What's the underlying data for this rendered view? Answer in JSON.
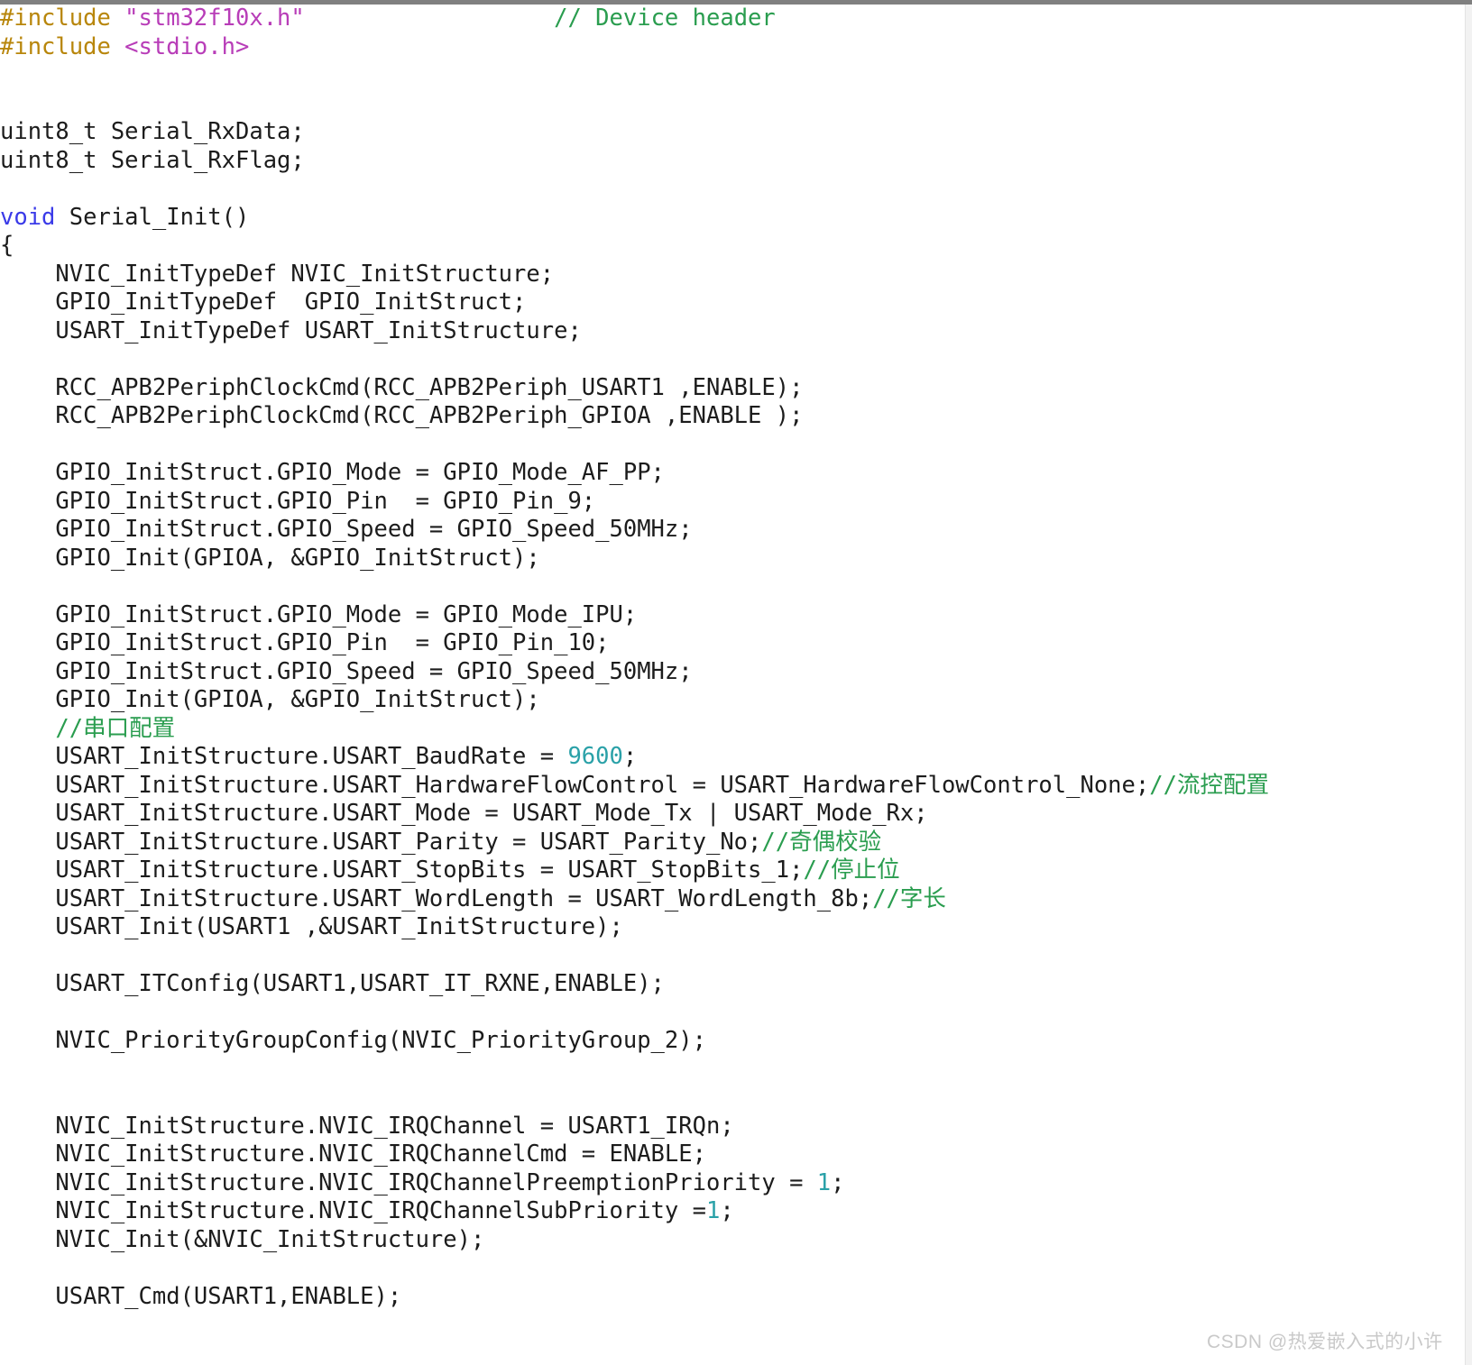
{
  "editor": {
    "language": "c",
    "colors": {
      "preprocessor": "#b8860b",
      "string": "#b83db8",
      "comment": "#2a9d4f",
      "keyword": "#3a3ae8",
      "number": "#2aa1a8",
      "text": "#1c1c1c",
      "background": "#ffffff",
      "topbar": "#808080",
      "scrollbar": "#f2f2f2"
    }
  },
  "watermark": {
    "text": "CSDN @热爱嵌入式的小许"
  },
  "code": {
    "lines": [
      {
        "id": 1,
        "segments": [
          {
            "cls": "pp",
            "t": "#include "
          },
          {
            "cls": "str",
            "t": "\"stm32f10x.h\""
          },
          {
            "cls": "plain",
            "t": "                  "
          },
          {
            "cls": "cmt",
            "t": "// Device header"
          }
        ]
      },
      {
        "id": 2,
        "segments": [
          {
            "cls": "pp",
            "t": "#include "
          },
          {
            "cls": "str",
            "t": "<stdio.h>"
          }
        ]
      },
      {
        "id": 3,
        "segments": [
          {
            "cls": "plain",
            "t": ""
          }
        ]
      },
      {
        "id": 4,
        "segments": [
          {
            "cls": "plain",
            "t": ""
          }
        ]
      },
      {
        "id": 5,
        "segments": [
          {
            "cls": "plain",
            "t": "uint8_t Serial_RxData;"
          }
        ]
      },
      {
        "id": 6,
        "segments": [
          {
            "cls": "plain",
            "t": "uint8_t Serial_RxFlag;"
          }
        ]
      },
      {
        "id": 7,
        "segments": [
          {
            "cls": "plain",
            "t": ""
          }
        ]
      },
      {
        "id": 8,
        "segments": [
          {
            "cls": "kw",
            "t": "void"
          },
          {
            "cls": "plain",
            "t": " Serial_Init()"
          }
        ]
      },
      {
        "id": 9,
        "segments": [
          {
            "cls": "plain",
            "t": "{"
          }
        ]
      },
      {
        "id": 10,
        "segments": [
          {
            "cls": "plain",
            "t": "    NVIC_InitTypeDef NVIC_InitStructure;"
          }
        ]
      },
      {
        "id": 11,
        "segments": [
          {
            "cls": "plain",
            "t": "    GPIO_InitTypeDef  GPIO_InitStruct;"
          }
        ]
      },
      {
        "id": 12,
        "segments": [
          {
            "cls": "plain",
            "t": "    USART_InitTypeDef USART_InitStructure;"
          }
        ]
      },
      {
        "id": 13,
        "segments": [
          {
            "cls": "plain",
            "t": ""
          }
        ]
      },
      {
        "id": 14,
        "segments": [
          {
            "cls": "plain",
            "t": "    RCC_APB2PeriphClockCmd(RCC_APB2Periph_USART1 ,ENABLE);"
          }
        ]
      },
      {
        "id": 15,
        "segments": [
          {
            "cls": "plain",
            "t": "    RCC_APB2PeriphClockCmd(RCC_APB2Periph_GPIOA ,ENABLE );"
          }
        ]
      },
      {
        "id": 16,
        "segments": [
          {
            "cls": "plain",
            "t": ""
          }
        ]
      },
      {
        "id": 17,
        "segments": [
          {
            "cls": "plain",
            "t": "    GPIO_InitStruct.GPIO_Mode = GPIO_Mode_AF_PP;"
          }
        ]
      },
      {
        "id": 18,
        "segments": [
          {
            "cls": "plain",
            "t": "    GPIO_InitStruct.GPIO_Pin  = GPIO_Pin_9;"
          }
        ]
      },
      {
        "id": 19,
        "segments": [
          {
            "cls": "plain",
            "t": "    GPIO_InitStruct.GPIO_Speed = GPIO_Speed_50MHz;"
          }
        ]
      },
      {
        "id": 20,
        "segments": [
          {
            "cls": "plain",
            "t": "    GPIO_Init(GPIOA, &GPIO_InitStruct);"
          }
        ]
      },
      {
        "id": 21,
        "segments": [
          {
            "cls": "plain",
            "t": ""
          }
        ]
      },
      {
        "id": 22,
        "segments": [
          {
            "cls": "plain",
            "t": "    GPIO_InitStruct.GPIO_Mode = GPIO_Mode_IPU;"
          }
        ]
      },
      {
        "id": 23,
        "segments": [
          {
            "cls": "plain",
            "t": "    GPIO_InitStruct.GPIO_Pin  = GPIO_Pin_10;"
          }
        ]
      },
      {
        "id": 24,
        "segments": [
          {
            "cls": "plain",
            "t": "    GPIO_InitStruct.GPIO_Speed = GPIO_Speed_50MHz;"
          }
        ]
      },
      {
        "id": 25,
        "segments": [
          {
            "cls": "plain",
            "t": "    GPIO_Init(GPIOA, &GPIO_InitStruct);"
          }
        ]
      },
      {
        "id": 26,
        "segments": [
          {
            "cls": "plain",
            "t": "    "
          },
          {
            "cls": "cmt",
            "t": "//串口配置"
          }
        ]
      },
      {
        "id": 27,
        "segments": [
          {
            "cls": "plain",
            "t": "    USART_InitStructure.USART_BaudRate = "
          },
          {
            "cls": "num",
            "t": "9600"
          },
          {
            "cls": "plain",
            "t": ";"
          }
        ]
      },
      {
        "id": 28,
        "segments": [
          {
            "cls": "plain",
            "t": "    USART_InitStructure.USART_HardwareFlowControl = USART_HardwareFlowControl_None;"
          },
          {
            "cls": "cmt",
            "t": "//流控配置"
          }
        ]
      },
      {
        "id": 29,
        "segments": [
          {
            "cls": "plain",
            "t": "    USART_InitStructure.USART_Mode = USART_Mode_Tx | USART_Mode_Rx;"
          }
        ]
      },
      {
        "id": 30,
        "segments": [
          {
            "cls": "plain",
            "t": "    USART_InitStructure.USART_Parity = USART_Parity_No;"
          },
          {
            "cls": "cmt",
            "t": "//奇偶校验"
          }
        ]
      },
      {
        "id": 31,
        "segments": [
          {
            "cls": "plain",
            "t": "    USART_InitStructure.USART_StopBits = USART_StopBits_1;"
          },
          {
            "cls": "cmt",
            "t": "//停止位"
          }
        ]
      },
      {
        "id": 32,
        "segments": [
          {
            "cls": "plain",
            "t": "    USART_InitStructure.USART_WordLength = USART_WordLength_8b;"
          },
          {
            "cls": "cmt",
            "t": "//字长"
          }
        ]
      },
      {
        "id": 33,
        "segments": [
          {
            "cls": "plain",
            "t": "    USART_Init(USART1 ,&USART_InitStructure);"
          }
        ]
      },
      {
        "id": 34,
        "segments": [
          {
            "cls": "plain",
            "t": ""
          }
        ]
      },
      {
        "id": 35,
        "segments": [
          {
            "cls": "plain",
            "t": "    USART_ITConfig(USART1,USART_IT_RXNE,ENABLE);"
          }
        ]
      },
      {
        "id": 36,
        "segments": [
          {
            "cls": "plain",
            "t": ""
          }
        ]
      },
      {
        "id": 37,
        "segments": [
          {
            "cls": "plain",
            "t": "    NVIC_PriorityGroupConfig(NVIC_PriorityGroup_2);"
          }
        ]
      },
      {
        "id": 38,
        "segments": [
          {
            "cls": "plain",
            "t": ""
          }
        ]
      },
      {
        "id": 39,
        "segments": [
          {
            "cls": "plain",
            "t": ""
          }
        ]
      },
      {
        "id": 40,
        "segments": [
          {
            "cls": "plain",
            "t": "    NVIC_InitStructure.NVIC_IRQChannel = USART1_IRQn;"
          }
        ]
      },
      {
        "id": 41,
        "segments": [
          {
            "cls": "plain",
            "t": "    NVIC_InitStructure.NVIC_IRQChannelCmd = ENABLE;"
          }
        ]
      },
      {
        "id": 42,
        "segments": [
          {
            "cls": "plain",
            "t": "    NVIC_InitStructure.NVIC_IRQChannelPreemptionPriority = "
          },
          {
            "cls": "num",
            "t": "1"
          },
          {
            "cls": "plain",
            "t": ";"
          }
        ]
      },
      {
        "id": 43,
        "segments": [
          {
            "cls": "plain",
            "t": "    NVIC_InitStructure.NVIC_IRQChannelSubPriority ="
          },
          {
            "cls": "num",
            "t": "1"
          },
          {
            "cls": "plain",
            "t": ";"
          }
        ]
      },
      {
        "id": 44,
        "segments": [
          {
            "cls": "plain",
            "t": "    NVIC_Init(&NVIC_InitStructure);"
          }
        ]
      },
      {
        "id": 45,
        "segments": [
          {
            "cls": "plain",
            "t": ""
          }
        ]
      },
      {
        "id": 46,
        "segments": [
          {
            "cls": "plain",
            "t": "    USART_Cmd(USART1,ENABLE);"
          }
        ]
      }
    ]
  }
}
